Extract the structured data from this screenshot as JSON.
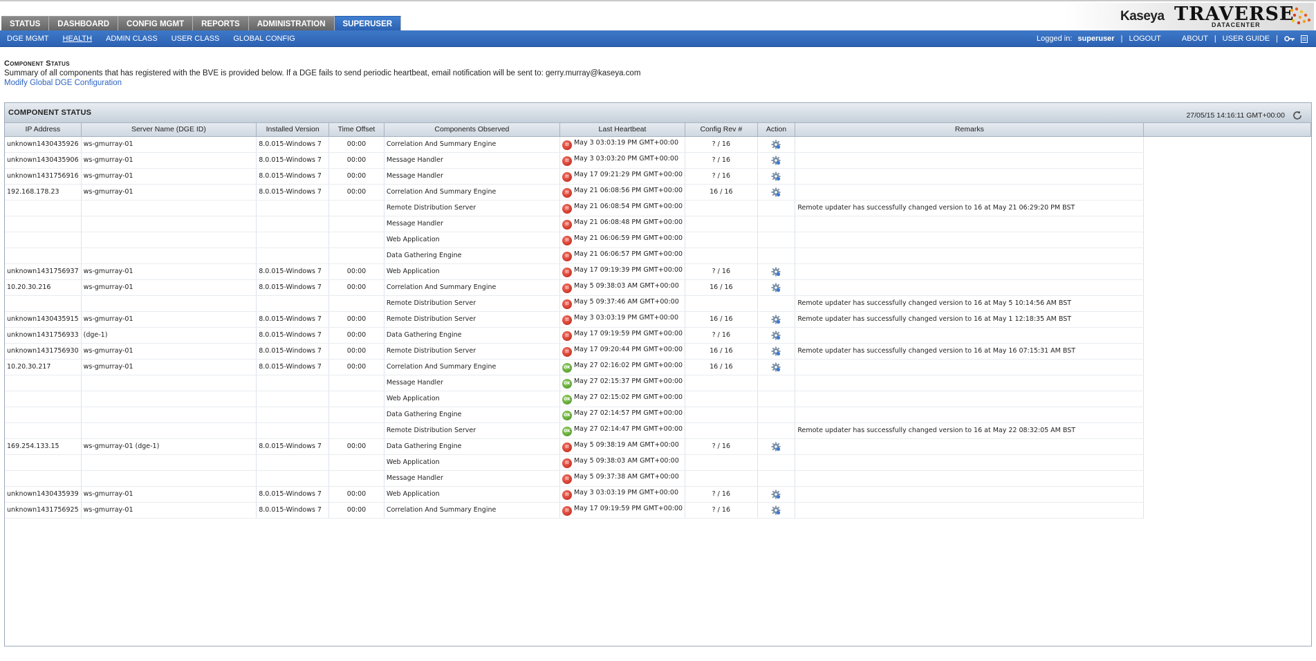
{
  "top_tabs": [
    "STATUS",
    "DASHBOARD",
    "CONFIG MGMT",
    "REPORTS",
    "ADMINISTRATION",
    "SUPERUSER"
  ],
  "brand": {
    "kaseya": "Kaseya",
    "traverse": "TRAVERSE",
    "datacenter": "DATACENTER"
  },
  "sub_tabs": [
    "DGE MGMT",
    "HEALTH",
    "ADMIN CLASS",
    "USER CLASS",
    "GLOBAL CONFIG"
  ],
  "session": {
    "logged_in_label": "Logged in:",
    "user": "superuser",
    "logout": "LOGOUT",
    "about": "ABOUT",
    "user_guide": "USER GUIDE"
  },
  "intro": {
    "heading": "Component Status",
    "summary": "Summary of all components that has registered with the BVE is provided below. If a DGE fails to send periodic heartbeat, email notification will be sent to: gerry.murray@kaseya.com",
    "link": "Modify Global DGE Configuration"
  },
  "panel": {
    "title": "COMPONENT STATUS",
    "timestamp": "27/05/15 14:16:11 GMT+00:00"
  },
  "columns": [
    "IP Address",
    "Server Name (DGE ID)",
    "Installed Version",
    "Time Offset",
    "Components Observed",
    "Last Heartbeat",
    "Config Rev #",
    "Action",
    "Remarks"
  ],
  "rows": [
    {
      "ip": "unknown1430435926",
      "server": "ws-gmurray-01",
      "version": "8.0.015-Windows 7",
      "offset": "00:00",
      "component": "Correlation And Summary Engine",
      "status": "err",
      "heartbeat": "May 3 03:03:19 PM GMT+00:00",
      "rev": "? / 16",
      "action": true,
      "remarks": ""
    },
    {
      "ip": "unknown1430435906",
      "server": "ws-gmurray-01",
      "version": "8.0.015-Windows 7",
      "offset": "00:00",
      "component": "Message Handler",
      "status": "err",
      "heartbeat": "May 3 03:03:20 PM GMT+00:00",
      "rev": "? / 16",
      "action": true,
      "remarks": ""
    },
    {
      "ip": "unknown1431756916",
      "server": "ws-gmurray-01",
      "version": "8.0.015-Windows 7",
      "offset": "00:00",
      "component": "Message Handler",
      "status": "err",
      "heartbeat": "May 17 09:21:29 PM GMT+00:00",
      "rev": "? / 16",
      "action": true,
      "remarks": ""
    },
    {
      "ip": "192.168.178.23",
      "server": "ws-gmurray-01",
      "version": "8.0.015-Windows 7",
      "offset": "00:00",
      "component": "Correlation And Summary Engine",
      "status": "err",
      "heartbeat": "May 21 06:08:56 PM GMT+00:00",
      "rev": "16 / 16",
      "action": true,
      "remarks": ""
    },
    {
      "ip": "",
      "server": "",
      "version": "",
      "offset": "",
      "component": "Remote Distribution Server",
      "status": "err",
      "heartbeat": "May 21 06:08:54 PM GMT+00:00",
      "rev": "",
      "action": false,
      "remarks": "Remote updater has successfully changed version to 16 at May 21 06:29:20 PM BST"
    },
    {
      "ip": "",
      "server": "",
      "version": "",
      "offset": "",
      "component": "Message Handler",
      "status": "err",
      "heartbeat": "May 21 06:08:48 PM GMT+00:00",
      "rev": "",
      "action": false,
      "remarks": ""
    },
    {
      "ip": "",
      "server": "",
      "version": "",
      "offset": "",
      "component": "Web Application",
      "status": "err",
      "heartbeat": "May 21 06:06:59 PM GMT+00:00",
      "rev": "",
      "action": false,
      "remarks": ""
    },
    {
      "ip": "",
      "server": "",
      "version": "",
      "offset": "",
      "component": "Data Gathering Engine",
      "status": "err",
      "heartbeat": "May 21 06:06:57 PM GMT+00:00",
      "rev": "",
      "action": false,
      "remarks": ""
    },
    {
      "ip": "unknown1431756937",
      "server": "ws-gmurray-01",
      "version": "8.0.015-Windows 7",
      "offset": "00:00",
      "component": "Web Application",
      "status": "err",
      "heartbeat": "May 17 09:19:39 PM GMT+00:00",
      "rev": "? / 16",
      "action": true,
      "remarks": ""
    },
    {
      "ip": "10.20.30.216",
      "server": "ws-gmurray-01",
      "version": "8.0.015-Windows 7",
      "offset": "00:00",
      "component": "Correlation And Summary Engine",
      "status": "err",
      "heartbeat": "May 5 09:38:03 AM GMT+00:00",
      "rev": "16 / 16",
      "action": true,
      "remarks": ""
    },
    {
      "ip": "",
      "server": "",
      "version": "",
      "offset": "",
      "component": "Remote Distribution Server",
      "status": "err",
      "heartbeat": "May 5 09:37:46 AM GMT+00:00",
      "rev": "",
      "action": false,
      "remarks": "Remote updater has successfully changed version to 16 at May 5 10:14:56 AM BST"
    },
    {
      "ip": "unknown1430435915",
      "server": "ws-gmurray-01",
      "version": "8.0.015-Windows 7",
      "offset": "00:00",
      "component": "Remote Distribution Server",
      "status": "err",
      "heartbeat": "May 3 03:03:19 PM GMT+00:00",
      "rev": "16 / 16",
      "action": true,
      "remarks": "Remote updater has successfully changed version to 16 at May 1 12:18:35 AM BST"
    },
    {
      "ip": "unknown1431756933",
      "server": "(dge-1)",
      "version": "8.0.015-Windows 7",
      "offset": "00:00",
      "component": "Data Gathering Engine",
      "status": "err",
      "heartbeat": "May 17 09:19:59 PM GMT+00:00",
      "rev": "? / 16",
      "action": true,
      "remarks": ""
    },
    {
      "ip": "unknown1431756930",
      "server": "ws-gmurray-01",
      "version": "8.0.015-Windows 7",
      "offset": "00:00",
      "component": "Remote Distribution Server",
      "status": "err",
      "heartbeat": "May 17 09:20:44 PM GMT+00:00",
      "rev": "16 / 16",
      "action": true,
      "remarks": "Remote updater has successfully changed version to 16 at May 16 07:15:31 AM BST"
    },
    {
      "ip": "10.20.30.217",
      "server": "ws-gmurray-01",
      "version": "8.0.015-Windows 7",
      "offset": "00:00",
      "component": "Correlation And Summary Engine",
      "status": "ok",
      "heartbeat": "May 27 02:16:02 PM GMT+00:00",
      "rev": "16 / 16",
      "action": true,
      "remarks": ""
    },
    {
      "ip": "",
      "server": "",
      "version": "",
      "offset": "",
      "component": "Message Handler",
      "status": "ok",
      "heartbeat": "May 27 02:15:37 PM GMT+00:00",
      "rev": "",
      "action": false,
      "remarks": ""
    },
    {
      "ip": "",
      "server": "",
      "version": "",
      "offset": "",
      "component": "Web Application",
      "status": "ok",
      "heartbeat": "May 27 02:15:02 PM GMT+00:00",
      "rev": "",
      "action": false,
      "remarks": ""
    },
    {
      "ip": "",
      "server": "",
      "version": "",
      "offset": "",
      "component": "Data Gathering Engine",
      "status": "ok",
      "heartbeat": "May 27 02:14:57 PM GMT+00:00",
      "rev": "",
      "action": false,
      "remarks": ""
    },
    {
      "ip": "",
      "server": "",
      "version": "",
      "offset": "",
      "component": "Remote Distribution Server",
      "status": "ok",
      "heartbeat": "May 27 02:14:47 PM GMT+00:00",
      "rev": "",
      "action": false,
      "remarks": "Remote updater has successfully changed version to 16 at May 22 08:32:05 AM BST"
    },
    {
      "ip": "169.254.133.15",
      "server": "ws-gmurray-01 (dge-1)",
      "version": "8.0.015-Windows 7",
      "offset": "00:00",
      "component": "Data Gathering Engine",
      "status": "err",
      "heartbeat": "May 5 09:38:19 AM GMT+00:00",
      "rev": "? / 16",
      "action": true,
      "remarks": ""
    },
    {
      "ip": "",
      "server": "",
      "version": "",
      "offset": "",
      "component": "Web Application",
      "status": "err",
      "heartbeat": "May 5 09:38:03 AM GMT+00:00",
      "rev": "",
      "action": false,
      "remarks": ""
    },
    {
      "ip": "",
      "server": "",
      "version": "",
      "offset": "",
      "component": "Message Handler",
      "status": "err",
      "heartbeat": "May 5 09:37:38 AM GMT+00:00",
      "rev": "",
      "action": false,
      "remarks": ""
    },
    {
      "ip": "unknown1430435939",
      "server": "ws-gmurray-01",
      "version": "8.0.015-Windows 7",
      "offset": "00:00",
      "component": "Web Application",
      "status": "err",
      "heartbeat": "May 3 03:03:19 PM GMT+00:00",
      "rev": "? / 16",
      "action": true,
      "remarks": ""
    },
    {
      "ip": "unknown1431756925",
      "server": "ws-gmurray-01",
      "version": "8.0.015-Windows 7",
      "offset": "00:00",
      "component": "Correlation And Summary Engine",
      "status": "err",
      "heartbeat": "May 17 09:19:59 PM GMT+00:00",
      "rev": "? / 16",
      "action": true,
      "remarks": ""
    }
  ],
  "status_icons": {
    "err": "!!",
    "ok": "OK"
  },
  "icons": {
    "action": "gear-icon",
    "refresh": "refresh-icon",
    "key": "key-icon",
    "menu": "menu-icon"
  },
  "colors": {
    "nav_blue": "#2d62b3",
    "tab_gray": "#6e6e6e",
    "link_blue": "#2e64c2",
    "error_red": "#c0150a",
    "ok_green": "#3f8d1a"
  }
}
